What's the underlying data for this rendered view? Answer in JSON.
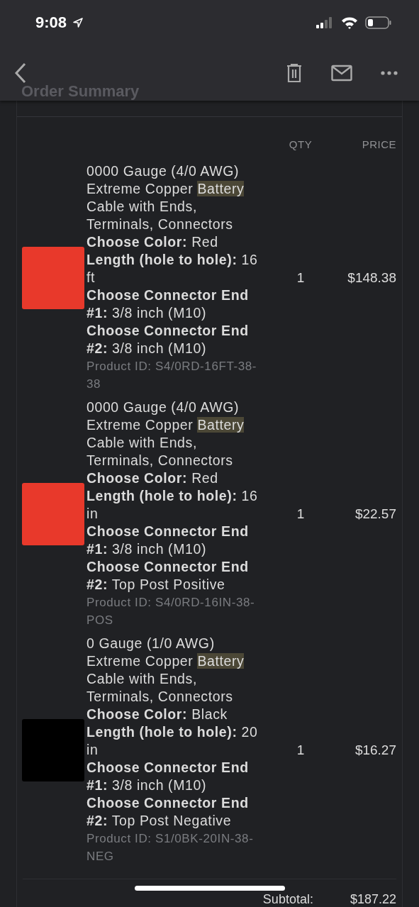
{
  "status_bar": {
    "time": "9:08"
  },
  "nav": {
    "faded_title": "Order Summary"
  },
  "table": {
    "columns": [
      "QTY",
      "PRICE"
    ],
    "rows": [
      {
        "color": "#e8392b",
        "title_start": "0000 Gauge (4/0 AWG) Extreme Copper",
        "highlight": "Battery",
        "title_end": "Cable with Ends, Terminals, Connectors",
        "options": [
          {
            "label": "Choose Color:",
            "value": "Red"
          },
          {
            "label": "Length (hole to hole):",
            "value": "16 ft"
          },
          {
            "label": "Choose Connector End #1:",
            "value": "3/8 inch (M10)"
          },
          {
            "label": "Choose Connector End #2:",
            "value": "3/8 inch (M10)"
          }
        ],
        "product_id": "Product ID: S4/0RD-16FT-38-38",
        "qty": "1",
        "price": "$148.38"
      },
      {
        "color": "#e8392b",
        "title_start": "0000 Gauge (4/0 AWG) Extreme Copper",
        "highlight": "Battery",
        "title_end": "Cable with Ends, Terminals, Connectors",
        "options": [
          {
            "label": "Choose Color:",
            "value": "Red"
          },
          {
            "label": "Length (hole to hole):",
            "value": "16 in"
          },
          {
            "label": "Choose Connector End #1:",
            "value": "3/8 inch (M10)"
          },
          {
            "label": "Choose Connector End #2:",
            "value": "Top Post Positive"
          }
        ],
        "product_id": "Product ID: S4/0RD-16IN-38-POS",
        "qty": "1",
        "price": "$22.57"
      },
      {
        "color": "#000000",
        "title_start": "0 Gauge (1/0 AWG) Extreme Copper",
        "highlight": "Battery",
        "title_end": "Cable with Ends, Terminals, Connectors",
        "options": [
          {
            "label": "Choose Color:",
            "value": "Black"
          },
          {
            "label": "Length (hole to hole):",
            "value": "20 in"
          },
          {
            "label": "Choose Connector End #1:",
            "value": "3/8 inch (M10)"
          },
          {
            "label": "Choose Connector End #2:",
            "value": "Top Post Negative"
          }
        ],
        "product_id": "Product ID: S1/0BK-20IN-38-NEG",
        "qty": "1",
        "price": "$16.27"
      }
    ]
  },
  "summary": {
    "label": "Subtotal:",
    "value": "$187.22"
  }
}
